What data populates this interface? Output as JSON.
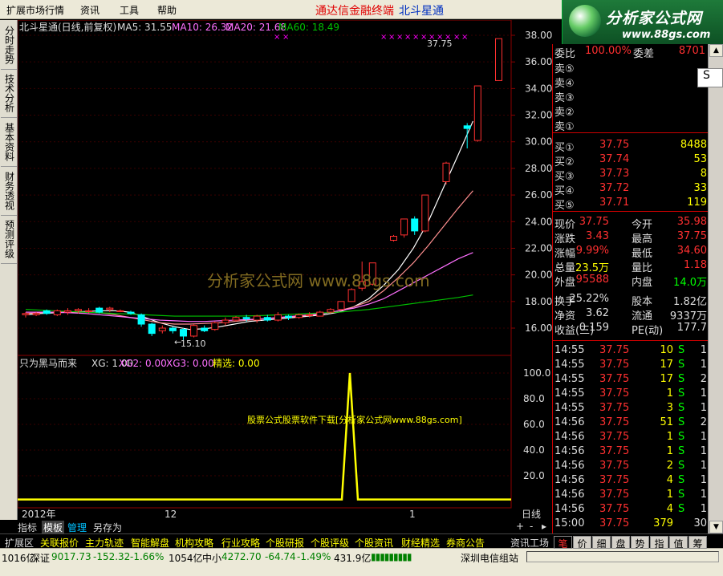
{
  "menu": [
    "扩展市场行情",
    "资讯",
    "工具",
    "帮助"
  ],
  "banner": {
    "left": "通达信金融终端",
    "right": "北斗星通"
  },
  "logo": {
    "title": "分析家公式网",
    "url": "www.88gs.com"
  },
  "side_tabs": [
    "分时走势",
    "技术分析",
    "基本资料",
    "财务透视",
    "预测评级"
  ],
  "chart_header": {
    "name": "北斗星通(日线,前复权)",
    "ma5": "MA5: 31.55",
    "ma10": "MA10: 26.32",
    "ma20": "MA20: 21.68",
    "ma60": "MA60: 18.49"
  },
  "y_ticks": [
    "38.00",
    "36.00",
    "34.00",
    "32.00",
    "30.00",
    "28.00",
    "26.00",
    "24.00",
    "22.00",
    "20.00",
    "18.00",
    "16.00"
  ],
  "high_label": "37.75",
  "low_label": "15.10",
  "watermark": "分析家公式网  www.88gs.com",
  "indicator_header": {
    "name": "只为黑马而来",
    "xg": "XG: 1.00",
    "xg2": "XG2: 0.00",
    "xg3": "XG3: 0.00",
    "jx": "精选: 0.00"
  },
  "ind_ticks": [
    "100.0",
    "80.0",
    "60.0",
    "40.0",
    "20.0"
  ],
  "ind_text": "股票公式股票软件下载[分析家公式网www.88gs.com]",
  "x_labels": {
    "year": "2012年",
    "m12": "12",
    "m1": "1",
    "period": "日线"
  },
  "tabs": [
    "指标",
    "模板",
    "管理",
    "另存为"
  ],
  "bottom_tabs": [
    "扩展区",
    "关联报价",
    "主力轨迹",
    "智能解盘",
    "机构攻略",
    "行业攻略",
    "个股研报",
    "个股评级",
    "个股资讯",
    "财经精选",
    "券商公告"
  ],
  "right_tab": "资讯工场",
  "quote": {
    "weibi_label": "委比",
    "weibi": "100.00%",
    "weicha_label": "委差",
    "weicha": "8701",
    "sells": [
      "卖⑤",
      "卖④",
      "卖③",
      "卖②",
      "卖①"
    ],
    "buys": [
      {
        "label": "买①",
        "price": "37.75",
        "vol": "8488"
      },
      {
        "label": "买②",
        "price": "37.74",
        "vol": "53"
      },
      {
        "label": "买③",
        "price": "37.73",
        "vol": "8"
      },
      {
        "label": "买④",
        "price": "37.72",
        "vol": "33"
      },
      {
        "label": "买⑤",
        "price": "37.71",
        "vol": "119"
      }
    ],
    "stats": [
      {
        "l1": "现价",
        "v1": "37.75",
        "l2": "今开",
        "v2": "35.98"
      },
      {
        "l1": "涨跌",
        "v1": "3.43",
        "l2": "最高",
        "v2": "37.75"
      },
      {
        "l1": "涨幅",
        "v1": "9.99%",
        "l2": "最低",
        "v2": "34.60"
      },
      {
        "l1": "总量",
        "v1": "23.5万",
        "l2": "量比",
        "v2": "1.18"
      },
      {
        "l1": "外盘",
        "v1": "95588",
        "l2": "内盘",
        "v2": "14.0万"
      },
      {
        "l1": "换手",
        "v1": "25.22%",
        "l2": "股本",
        "v2": "1.82亿"
      },
      {
        "l1": "净资",
        "v1": "3.62",
        "l2": "流通",
        "v2": "9337万"
      },
      {
        "l1": "收益(三)",
        "v1": "0.159",
        "l2": "PE(动)",
        "v2": "177.7"
      }
    ],
    "ticks": [
      {
        "t": "14:55",
        "p": "37.75",
        "v": "10",
        "s": "S",
        "n": "1"
      },
      {
        "t": "14:55",
        "p": "37.75",
        "v": "17",
        "s": "S",
        "n": "1"
      },
      {
        "t": "14:55",
        "p": "37.75",
        "v": "17",
        "s": "S",
        "n": "2"
      },
      {
        "t": "14:55",
        "p": "37.75",
        "v": "1",
        "s": "S",
        "n": "1"
      },
      {
        "t": "14:55",
        "p": "37.75",
        "v": "3",
        "s": "S",
        "n": "1"
      },
      {
        "t": "14:56",
        "p": "37.75",
        "v": "51",
        "s": "S",
        "n": "2"
      },
      {
        "t": "14:56",
        "p": "37.75",
        "v": "1",
        "s": "S",
        "n": "1"
      },
      {
        "t": "14:56",
        "p": "37.75",
        "v": "1",
        "s": "S",
        "n": "1"
      },
      {
        "t": "14:56",
        "p": "37.75",
        "v": "2",
        "s": "S",
        "n": "1"
      },
      {
        "t": "14:56",
        "p": "37.75",
        "v": "4",
        "s": "S",
        "n": "1"
      },
      {
        "t": "14:56",
        "p": "37.75",
        "v": "1",
        "s": "S",
        "n": "1"
      },
      {
        "t": "14:56",
        "p": "37.75",
        "v": "4",
        "s": "S",
        "n": "1"
      },
      {
        "t": "15:00",
        "p": "37.75",
        "v": "379",
        "s": "",
        "n": "30"
      }
    ],
    "bottom_tabs": [
      "笔",
      "价",
      "细",
      "盘",
      "势",
      "指",
      "值",
      "筹"
    ]
  },
  "status": {
    "left": "1016亿",
    "sz_label": "深证",
    "sz": "9017.73",
    "sz_chg": "-152.32",
    "sz_pct": "-1.66%",
    "sz_amt": "1054亿",
    "zx_label": "中小",
    "zx": "4272.70",
    "zx_chg": "-64.74",
    "zx_pct": "-1.49%",
    "zx_amt": "431.9亿",
    "server": "深圳电信组站"
  },
  "colors": {
    "up": "#ff3030",
    "down": "#00ffff",
    "yellow": "#ffff00",
    "grid": "#8b0000"
  }
}
